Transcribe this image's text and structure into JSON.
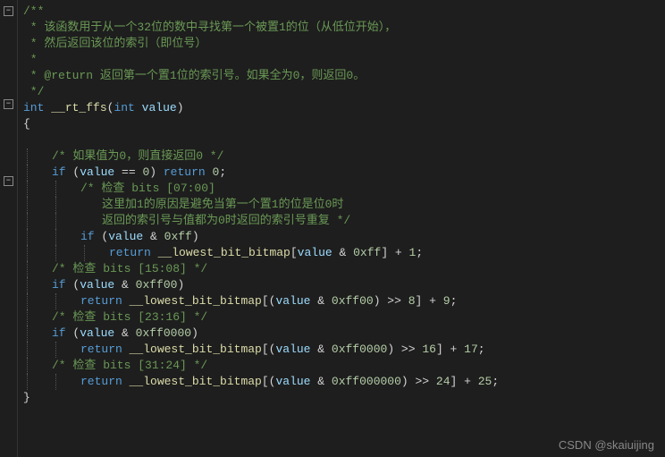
{
  "fold_symbols": [
    "−",
    "−",
    "−"
  ],
  "lines": [
    {
      "type": "comment",
      "text": "/**",
      "indent": 0
    },
    {
      "type": "comment",
      "text": " * 该函数用于从一个32位的数中寻找第一个被置1的位（从低位开始），",
      "indent": 0
    },
    {
      "type": "comment",
      "text": " * 然后返回该位的索引（即位号）",
      "indent": 0
    },
    {
      "type": "comment",
      "text": " *",
      "indent": 0
    },
    {
      "type": "comment",
      "text": " * @return 返回第一个置1位的索引号。如果全为0，则返回0。",
      "indent": 0
    },
    {
      "type": "comment",
      "text": " */",
      "indent": 0
    },
    {
      "type": "sig",
      "text": "int __rt_ffs(int value)"
    },
    {
      "type": "brace",
      "text": "{",
      "indent": 0
    },
    {
      "type": "blank"
    },
    {
      "type": "comment",
      "text": "/* 如果值为0，则直接返回0 */",
      "indent": 1
    },
    {
      "type": "code",
      "text": "if (value == 0) return 0;",
      "indent": 1
    },
    {
      "type": "comment",
      "text": "/* 检查 bits [07:00]",
      "indent": 2
    },
    {
      "type": "comment",
      "text": "这里加1的原因是避免当第一个置1的位是位0时",
      "indent": 2,
      "extra": 3
    },
    {
      "type": "comment",
      "text": "返回的索引号与值都为0时返回的索引号重复 */",
      "indent": 2,
      "extra": 3
    },
    {
      "type": "code",
      "text": "if (value & 0xff)",
      "indent": 2
    },
    {
      "type": "code",
      "text": "return __lowest_bit_bitmap[value & 0xff] + 1;",
      "indent": 3
    },
    {
      "type": "comment",
      "text": "/* 检查 bits [15:08] */",
      "indent": 1
    },
    {
      "type": "code",
      "text": "if (value & 0xff00)",
      "indent": 1
    },
    {
      "type": "code",
      "text": "return __lowest_bit_bitmap[(value & 0xff00) >> 8] + 9;",
      "indent": 2
    },
    {
      "type": "comment",
      "text": "/* 检查 bits [23:16] */",
      "indent": 1
    },
    {
      "type": "code",
      "text": "if (value & 0xff0000)",
      "indent": 1
    },
    {
      "type": "code",
      "text": "return __lowest_bit_bitmap[(value & 0xff0000) >> 16] + 17;",
      "indent": 2
    },
    {
      "type": "comment",
      "text": "/* 检查 bits [31:24] */",
      "indent": 1
    },
    {
      "type": "code",
      "text": "return __lowest_bit_bitmap[(value & 0xff000000) >> 24] + 25;",
      "indent": 2
    },
    {
      "type": "brace",
      "text": "}",
      "indent": 0
    }
  ],
  "watermark": "CSDN @skaiuijing"
}
